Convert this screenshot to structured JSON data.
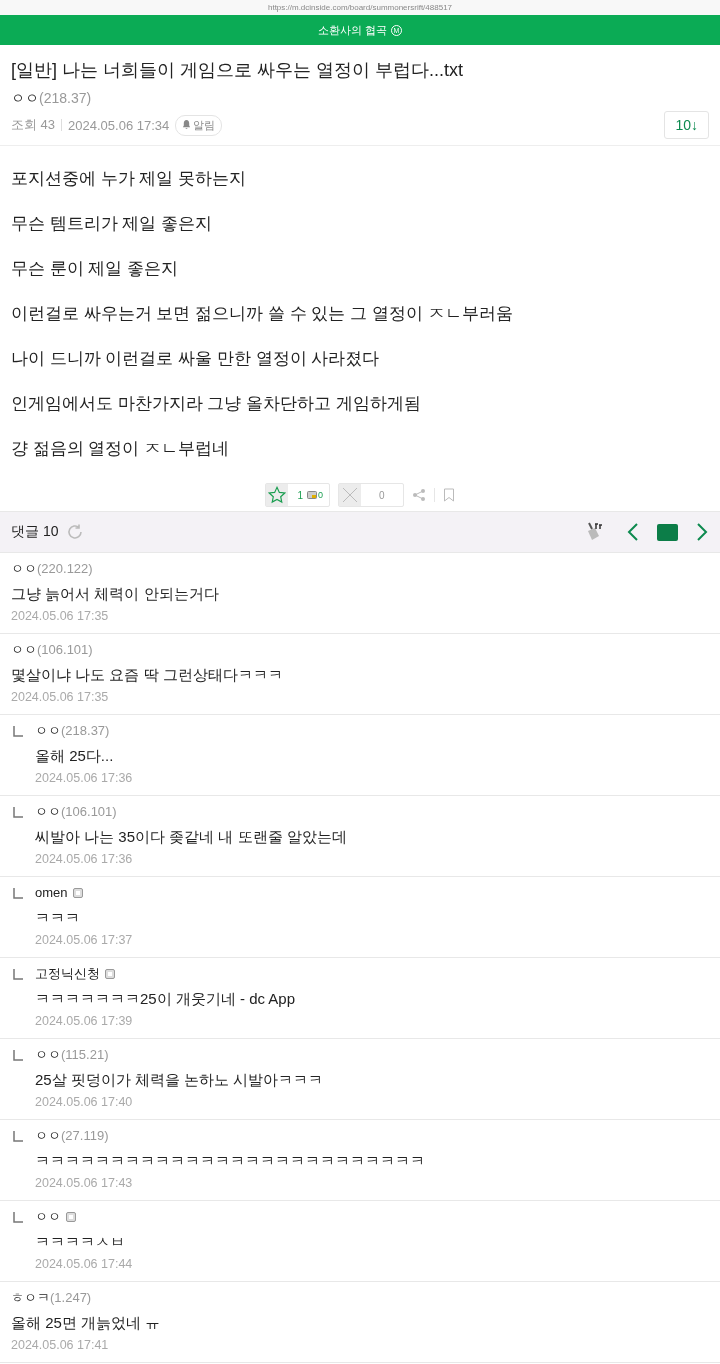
{
  "url": "https://m.dcinside.com/board/summonersrift/488517",
  "header": {
    "title": "소환사의 협곡",
    "badge": "M"
  },
  "post": {
    "title": "[일반] 나는 너희들이 게임으로 싸우는 열정이 부럽다...txt",
    "author": "ㅇㅇ",
    "ip": "(218.37)",
    "views": "조회 43",
    "date": "2024.05.06 17:34",
    "alert": "알림",
    "comment_jump": "10↓",
    "body": [
      "포지션중에 누가 제일 못하는지",
      "무슨 템트리가 제일 좋은지",
      "무슨 룬이 제일 좋은지",
      "이런걸로 싸우는거 보면 젊으니까 쓸 수 있는 그 열정이 ㅈㄴ부러움",
      "나이 드니까 이런걸로 싸울 만한 열정이 사라졌다",
      "인게임에서도 마찬가지라 그냥 올차단하고 게임하게됨",
      "걍 젊음의 열정이 ㅈㄴ부럽네"
    ]
  },
  "votes": {
    "up": "1",
    "fixed_up": "0",
    "down": "0"
  },
  "comments_header": {
    "label": "댓글 10"
  },
  "comments": [
    {
      "kind": "comment",
      "author": "ㅇㅇ",
      "ip": "(220.122)",
      "member": false,
      "text": "그냥 늙어서 체력이 안되는거다",
      "date": "2024.05.06 17:35"
    },
    {
      "kind": "comment",
      "author": "ㅇㅇ",
      "ip": "(106.101)",
      "member": false,
      "text": "몇살이냐 나도 요즘 딱 그런상태다ㅋㅋㅋ",
      "date": "2024.05.06 17:35"
    },
    {
      "kind": "reply",
      "author": "ㅇㅇ",
      "ip": "(218.37)",
      "member": false,
      "text": "올해 25다...",
      "date": "2024.05.06 17:36"
    },
    {
      "kind": "reply",
      "author": "ㅇㅇ",
      "ip": "(106.101)",
      "member": false,
      "text": "씨발아 나는 35이다 좆같네 내 또랜줄 알았는데",
      "date": "2024.05.06 17:36"
    },
    {
      "kind": "reply",
      "author": "omen",
      "member": true,
      "text": "ㅋㅋㅋ",
      "date": "2024.05.06 17:37"
    },
    {
      "kind": "reply",
      "author": "고정닉신청",
      "member": true,
      "text": "ㅋㅋㅋㅋㅋㅋㅋ25이 개웃기네 - dc App",
      "date": "2024.05.06 17:39"
    },
    {
      "kind": "reply",
      "author": "ㅇㅇ",
      "ip": "(115.21)",
      "member": false,
      "text": "25살 핏덩이가 체력을 논하노 시발아ㅋㅋㅋ",
      "date": "2024.05.06 17:40"
    },
    {
      "kind": "reply",
      "author": "ㅇㅇ",
      "ip": "(27.119)",
      "member": false,
      "text": "ㅋㅋㅋㅋㅋㅋㅋㅋㅋㅋㅋㅋㅋㅋㅋㅋㅋㅋㅋㅋㅋㅋㅋㅋㅋㅋ",
      "date": "2024.05.06 17:43"
    },
    {
      "kind": "reply",
      "author": "ㅇㅇ",
      "member": true,
      "text": "ㅋㅋㅋㅋㅅㅂ",
      "date": "2024.05.06 17:44"
    },
    {
      "kind": "comment",
      "author": "ㅎㅇㅋ",
      "ip": "(1.247)",
      "member": false,
      "text": "올해 25면 개늙었네 ㅠ",
      "date": "2024.05.06 17:41"
    }
  ]
}
